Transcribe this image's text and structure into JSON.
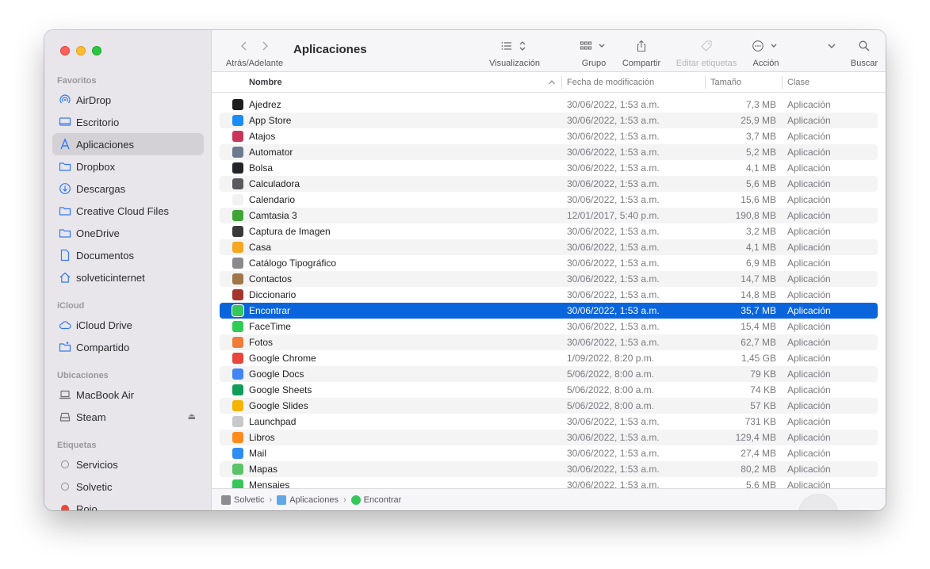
{
  "window": {
    "title": "Aplicaciones"
  },
  "toolbar": {
    "nav_label": "Atrás/Adelante",
    "view_label": "Visualización",
    "group_label": "Grupo",
    "share_label": "Compartir",
    "tags_label": "Editar etiquetas",
    "action_label": "Acción",
    "search_label": "Buscar"
  },
  "sidebar": {
    "favorites_heading": "Favoritos",
    "favorites": [
      {
        "label": "AirDrop",
        "icon": "airdrop-icon"
      },
      {
        "label": "Escritorio",
        "icon": "desktop-icon"
      },
      {
        "label": "Aplicaciones",
        "icon": "applications-icon"
      },
      {
        "label": "Dropbox",
        "icon": "folder-icon"
      },
      {
        "label": "Descargas",
        "icon": "download-icon"
      },
      {
        "label": "Creative Cloud Files",
        "icon": "folder-icon"
      },
      {
        "label": "OneDrive",
        "icon": "folder-icon"
      },
      {
        "label": "Documentos",
        "icon": "document-icon"
      },
      {
        "label": "solveticinternet",
        "icon": "home-icon"
      }
    ],
    "icloud_heading": "iCloud",
    "icloud": [
      {
        "label": "iCloud Drive",
        "icon": "cloud-icon"
      },
      {
        "label": "Compartido",
        "icon": "shared-folder-icon"
      }
    ],
    "locations_heading": "Ubicaciones",
    "locations": [
      {
        "label": "MacBook Air",
        "icon": "laptop-icon"
      },
      {
        "label": "Steam",
        "icon": "disk-icon"
      }
    ],
    "tags_heading": "Etiquetas",
    "tags": [
      {
        "label": "Servicios"
      },
      {
        "label": "Solvetic"
      },
      {
        "label": "Rojo"
      }
    ]
  },
  "columns": {
    "name": "Nombre",
    "date": "Fecha de modificación",
    "size": "Tamaño",
    "kind": "Clase"
  },
  "files": [
    {
      "name": "Ajedrez",
      "date": "30/06/2022, 1:53 a.m.",
      "size": "7,3 MB",
      "kind": "Aplicación",
      "color": "#1e1e1e"
    },
    {
      "name": "App Store",
      "date": "30/06/2022, 1:53 a.m.",
      "size": "25,9 MB",
      "kind": "Aplicación",
      "color": "#1a8cf5"
    },
    {
      "name": "Atajos",
      "date": "30/06/2022, 1:53 a.m.",
      "size": "3,7 MB",
      "kind": "Aplicación",
      "color": "#c9365c"
    },
    {
      "name": "Automator",
      "date": "30/06/2022, 1:53 a.m.",
      "size": "5,2 MB",
      "kind": "Aplicación",
      "color": "#6b7a8f"
    },
    {
      "name": "Bolsa",
      "date": "30/06/2022, 1:53 a.m.",
      "size": "4,1 MB",
      "kind": "Aplicación",
      "color": "#222428"
    },
    {
      "name": "Calculadora",
      "date": "30/06/2022, 1:53 a.m.",
      "size": "5,6 MB",
      "kind": "Aplicación",
      "color": "#5a5a5e"
    },
    {
      "name": "Calendario",
      "date": "30/06/2022, 1:53 a.m.",
      "size": "15,6 MB",
      "kind": "Aplicación",
      "color": "#f2f2f2"
    },
    {
      "name": "Camtasia 3",
      "date": "12/01/2017, 5:40 p.m.",
      "size": "190,8 MB",
      "kind": "Aplicación",
      "color": "#3fa535"
    },
    {
      "name": "Captura de Imagen",
      "date": "30/06/2022, 1:53 a.m.",
      "size": "3,2 MB",
      "kind": "Aplicación",
      "color": "#3a3a3c"
    },
    {
      "name": "Casa",
      "date": "30/06/2022, 1:53 a.m.",
      "size": "4,1 MB",
      "kind": "Aplicación",
      "color": "#f5a623"
    },
    {
      "name": "Catálogo Tipográfico",
      "date": "30/06/2022, 1:53 a.m.",
      "size": "6,9 MB",
      "kind": "Aplicación",
      "color": "#8a8a8e"
    },
    {
      "name": "Contactos",
      "date": "30/06/2022, 1:53 a.m.",
      "size": "14,7 MB",
      "kind": "Aplicación",
      "color": "#a07848"
    },
    {
      "name": "Diccionario",
      "date": "30/06/2022, 1:53 a.m.",
      "size": "14,8 MB",
      "kind": "Aplicación",
      "color": "#a3352d"
    },
    {
      "name": "Encontrar",
      "date": "30/06/2022, 1:53 a.m.",
      "size": "35,7 MB",
      "kind": "Aplicación",
      "color": "#34c759",
      "selected": true
    },
    {
      "name": "FaceTime",
      "date": "30/06/2022, 1:53 a.m.",
      "size": "15,4 MB",
      "kind": "Aplicación",
      "color": "#2ecc55"
    },
    {
      "name": "Fotos",
      "date": "30/06/2022, 1:53 a.m.",
      "size": "62,7 MB",
      "kind": "Aplicación",
      "color": "#f07c3a"
    },
    {
      "name": "Google Chrome",
      "date": "1/09/2022, 8:20 p.m.",
      "size": "1,45 GB",
      "kind": "Aplicación",
      "color": "#e8453c"
    },
    {
      "name": "Google Docs",
      "date": "5/06/2022, 8:00 a.m.",
      "size": "79 KB",
      "kind": "Aplicación",
      "color": "#4285f4"
    },
    {
      "name": "Google Sheets",
      "date": "5/06/2022, 8:00 a.m.",
      "size": "74 KB",
      "kind": "Aplicación",
      "color": "#0f9d58"
    },
    {
      "name": "Google Slides",
      "date": "5/06/2022, 8:00 a.m.",
      "size": "57 KB",
      "kind": "Aplicación",
      "color": "#f4b400"
    },
    {
      "name": "Launchpad",
      "date": "30/06/2022, 1:53 a.m.",
      "size": "731 KB",
      "kind": "Aplicación",
      "color": "#c8c8cc"
    },
    {
      "name": "Libros",
      "date": "30/06/2022, 1:53 a.m.",
      "size": "129,4 MB",
      "kind": "Aplicación",
      "color": "#ff8a1e"
    },
    {
      "name": "Mail",
      "date": "30/06/2022, 1:53 a.m.",
      "size": "27,4 MB",
      "kind": "Aplicación",
      "color": "#2f8cf0"
    },
    {
      "name": "Mapas",
      "date": "30/06/2022, 1:53 a.m.",
      "size": "80,2 MB",
      "kind": "Aplicación",
      "color": "#5cc26a"
    },
    {
      "name": "Mensajes",
      "date": "30/06/2022, 1:53 a.m.",
      "size": "5,6 MB",
      "kind": "Aplicación",
      "color": "#34c759"
    }
  ],
  "pathbar": {
    "items": [
      "Solvetic",
      "Aplicaciones",
      "Encontrar"
    ]
  }
}
